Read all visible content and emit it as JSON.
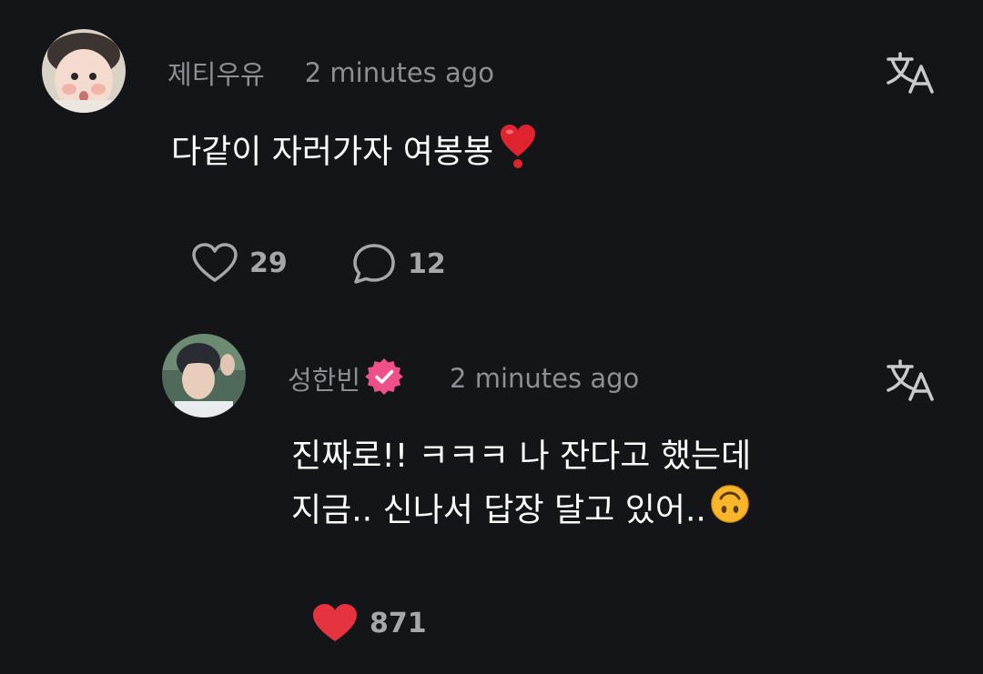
{
  "comments": [
    {
      "username": "제티우유",
      "timestamp": "2 minutes ago",
      "text": "다같이 자러가자 여봉봉",
      "likes": "29",
      "replies": "12",
      "liked": false,
      "verified": false
    },
    {
      "username": "성한빈",
      "timestamp": "2 minutes ago",
      "text_line1": "진짜로!! ㅋㅋㅋ 나 잔다고 했는데",
      "text_line2": "지금.. 신나서 답장 달고 있어..",
      "likes": "871",
      "liked": true,
      "verified": true
    }
  ],
  "colors": {
    "background": "#141518",
    "meta_text": "#8e8f96",
    "count_text": "#a6a7ad",
    "liked_heart": "#e5333f",
    "verified_badge": "#f0508a"
  },
  "icons": {
    "translate": "translate-icon",
    "like": "heart-icon",
    "reply": "chat-bubble-icon",
    "emoji1": "red-heart-emoji",
    "emoji2": "upside-down-face-emoji"
  }
}
